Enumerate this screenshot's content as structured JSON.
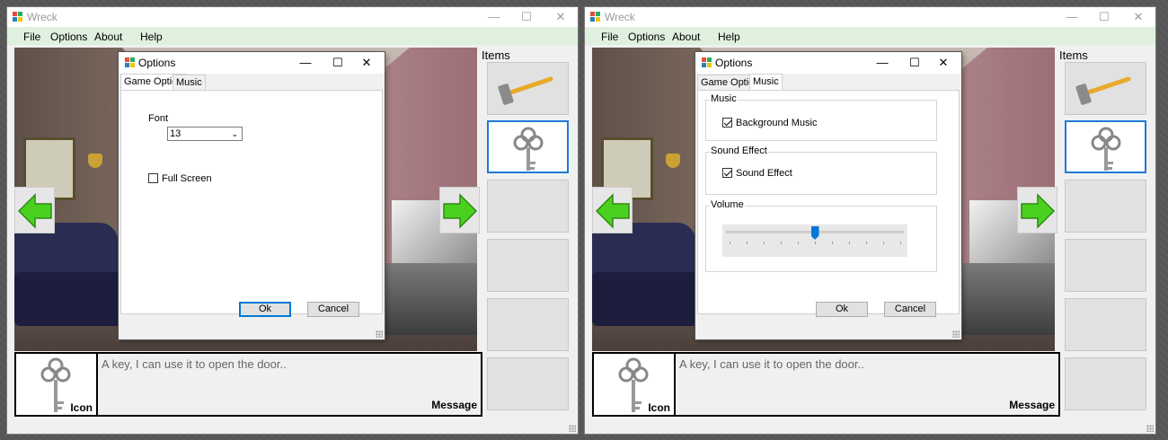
{
  "app": {
    "title": "Wreck"
  },
  "window_controls": {
    "minimize": "—",
    "maximize": "☐",
    "close": "✕"
  },
  "menu": {
    "file": "File",
    "options": "Options",
    "about": "About",
    "help": "Help"
  },
  "items_panel": {
    "label": "Items",
    "slots": [
      "hammer",
      "key",
      "",
      "",
      "",
      ""
    ],
    "selected_index": 1
  },
  "bottom_panel": {
    "icon_label": "Icon",
    "message": "A key, I can use it to open the door..",
    "message_label": "Message"
  },
  "dialog_game": {
    "title": "Options",
    "tabs": [
      "Game Option",
      "Music"
    ],
    "active_tab": "Game Option",
    "font_label": "Font",
    "font_value": "13",
    "fullscreen_label": "Full Screen",
    "fullscreen_checked": false,
    "ok_label": "Ok",
    "cancel_label": "Cancel"
  },
  "dialog_music": {
    "title": "Options",
    "tabs": [
      "Game Option",
      "Music"
    ],
    "active_tab": "Music",
    "music_group": "Music",
    "bg_music_label": "Background Music",
    "bg_music_checked": true,
    "sound_group": "Sound Effect",
    "sound_effect_label": "Sound Effect",
    "sound_effect_checked": true,
    "volume_group": "Volume",
    "volume_value": 0.5,
    "ok_label": "Ok",
    "cancel_label": "Cancel"
  },
  "colors": {
    "menubar": "#dff0df",
    "selection": "#1e7ad6",
    "arrow_green": "#3fbf1f",
    "slider_thumb": "#0078d7"
  }
}
